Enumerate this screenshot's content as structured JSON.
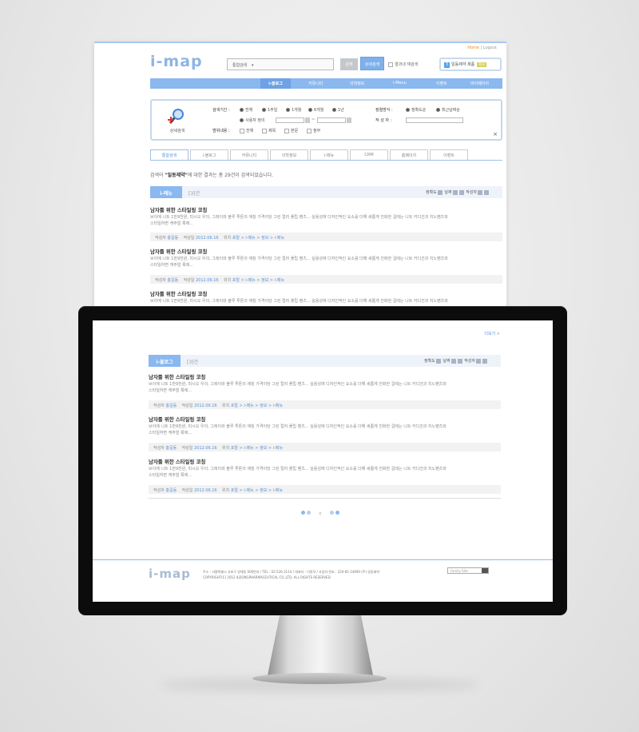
{
  "header": {
    "logo": "i-map",
    "home": "Home",
    "logout": "Logout",
    "sep": "|",
    "search_select": "통합검색",
    "search_button": "검색",
    "detail_button": "상세검색",
    "research_label": "결과내 재검색",
    "recent": {
      "num": "3",
      "text": "일동제약 제품",
      "tag": "확대"
    }
  },
  "gnb": [
    "i-블로그",
    "커뮤니티",
    "의학정보",
    "i-Menu",
    "이벤트",
    "마이페이지"
  ],
  "detail_search": {
    "icon_label": "상세검색",
    "period_label": "검색기간 :",
    "period_options": [
      "전체",
      "1주일",
      "1개월",
      "6개월",
      "1년"
    ],
    "custom_label": "사용자 정의",
    "range_sep": "~",
    "scope_label": "범위내용 :",
    "scope_options": [
      "전체",
      "제목",
      "본문",
      "첨부"
    ],
    "sort_label": "정렬방식 :",
    "sort_options": [
      "정확도순",
      "최근날짜순"
    ],
    "author_label": "작 성 자 :",
    "close": "×"
  },
  "tabs": [
    "통합검색",
    "i-블로그",
    "커뮤니티",
    "의학정보",
    "i-메뉴",
    "CRM",
    "홈페이지",
    "이벤트"
  ],
  "result_message": {
    "prefix": "검색어 ",
    "keyword": "\"일동제약\"",
    "suffix": "에 대한 결과는 총 29건이 검색되었습니다."
  },
  "sort_controls": {
    "accuracy": "정확도",
    "date": "날짜",
    "author": "작성자"
  },
  "section1": {
    "tag": "i-메뉴",
    "count": "[3]건"
  },
  "section2": {
    "tag": "i-블로그",
    "count": "[3]건"
  },
  "more_link": "더보기 >",
  "item": {
    "title": "남자를 위한 스타일링 코칭",
    "desc1": "브이에 니트 1만9천원, 미시오 우의, 그레이와 블루 투톤의 애칭 가격이당 그린 컬러 플립 팬츠... 실용성에 디자인적인 요소를 더해 세롭게 진화한 걸레는 니트 카디건과 치노팬츠와",
    "desc2": "스타일하면 캐주얼 룩에...",
    "author_label": "작성자",
    "author": "홍길동",
    "date_label": "작성일",
    "date": "2012.06.16",
    "location_label": "위치",
    "location": "포탈 > i-메뉴 > 정보 > i-메뉴"
  },
  "pager": {
    "current": "c"
  },
  "footer": {
    "logo": "i-map",
    "address": "주소 : 서울특별시 서초구 양재동 000번지  /  TEL : 02-526-3114  /  대표자 : 이정치  /  사업자 번호 : 220-81-14690  (주) 일동제약",
    "copyright": "COPYRIGHT(C) 2012 ILDONGPHARMACEUTICAL CO.,LTD. ALL RIGHTS RESERVED",
    "family_site": "Family Site"
  }
}
